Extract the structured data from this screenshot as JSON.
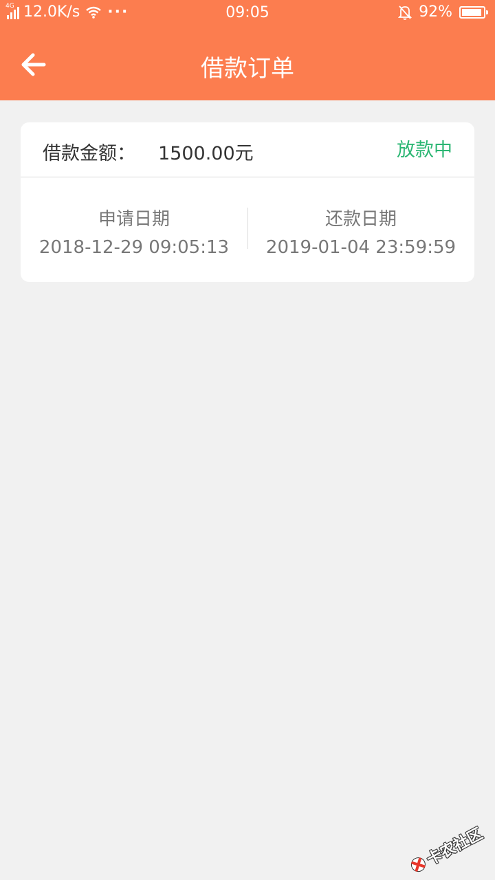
{
  "status_bar": {
    "network_tag": "4G",
    "speed": "12.0K/s",
    "more": "···",
    "time": "09:05",
    "battery": "92%"
  },
  "nav": {
    "title": "借款订单"
  },
  "order": {
    "amount_label": "借款金额：",
    "amount_value": "1500.00元",
    "status": "放款中",
    "status_color": "#2bb673",
    "apply_label": "申请日期",
    "apply_date": "2018-12-29 09:05:13",
    "repay_label": "还款日期",
    "repay_date": "2019-01-04 23:59:59"
  },
  "watermark": {
    "text": "卡农社区"
  },
  "colors": {
    "header": "#fc7d4f",
    "background": "#f1f1f1"
  }
}
